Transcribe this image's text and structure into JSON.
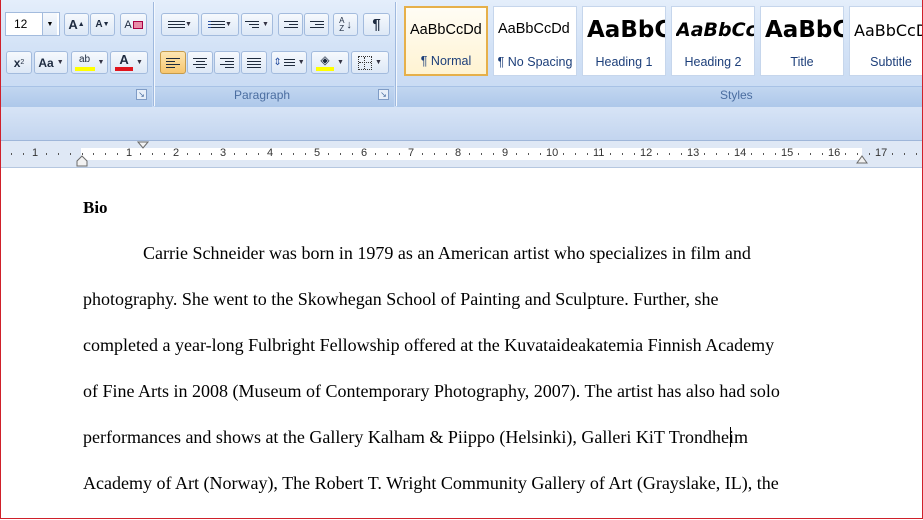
{
  "ribbon": {
    "font_size": "12",
    "font_size_up_label": "A",
    "font_size_down_label": "A",
    "clear_format_label": "A",
    "subscript_label": "x",
    "change_case_label": "Aa",
    "highlight_label": "ab",
    "font_color_label": "A",
    "pilcrow_label": "¶",
    "paragraph_group_label": "Paragraph",
    "styles_group_label": "Styles",
    "launcher_glyph": "↘"
  },
  "styles": [
    {
      "preview": "AaBbCcDd",
      "name": "¶ Normal",
      "selected": true
    },
    {
      "preview": "AaBbCcDd",
      "name": "¶ No Spacing",
      "selected": false
    },
    {
      "preview": "AaBbC",
      "name": "Heading 1",
      "selected": false
    },
    {
      "preview": "AaBbCc",
      "name": "Heading 2",
      "selected": false
    },
    {
      "preview": "AaBbC",
      "name": "Title",
      "selected": false
    },
    {
      "preview": "AaBbCcD",
      "name": "Subtitle",
      "selected": false
    }
  ],
  "ruler": {
    "numbers": [
      "1",
      "1",
      "2",
      "3",
      "4",
      "5",
      "6",
      "7",
      "8",
      "9",
      "10",
      "11",
      "12",
      "13",
      "14",
      "15",
      "16",
      "17"
    ]
  },
  "document": {
    "heading": "Bio",
    "lines": [
      "Carrie Schneider was born in 1979 as an American artist who specializes in film and",
      "photography. She went to the Skowhegan School of Painting and Sculpture. Further, she",
      "completed a year-long Fulbright Fellowship offered at the Kuvataideakatemia Finnish  Academy",
      "of Fine Arts in 2008 (Museum of Contemporary Photography, 2007). The artist has also had solo",
      "performances and shows at the Gallery Kalham & Piippo (Helsinki), Galleri KiT Trondheim",
      "Academy of Art (Norway), The Robert T. Wright Community Gallery of Art (Grayslake, IL), the"
    ]
  },
  "colors": {
    "highlight": "#ffff00",
    "font_color": "#e0141e",
    "selected_tile_border": "#e6b04a"
  }
}
